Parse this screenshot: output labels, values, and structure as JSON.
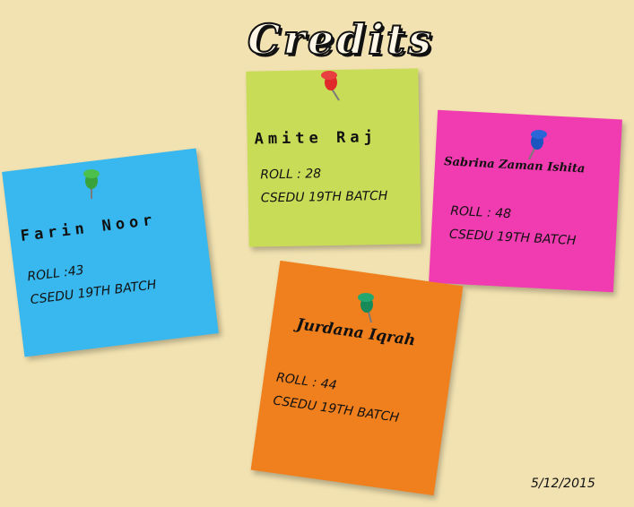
{
  "title": "Credits",
  "notes": {
    "green": {
      "name": "Amite Raj",
      "roll": "ROLL : 28",
      "batch": "CSEDU 19TH BATCH",
      "color": "#c8dc58",
      "pin_color": "#e02a2a"
    },
    "pink": {
      "name": "Sabrina Zaman Ishita",
      "roll": "ROLL  : 48",
      "batch": "CSEDU 19TH BATCH",
      "color": "#f03cb0",
      "pin_color": "#1a55c0"
    },
    "blue": {
      "name": "Farin Noor",
      "roll": "ROLL :43",
      "batch": "CSEDU 19TH BATCH",
      "color": "#38b8ee",
      "pin_color": "#3aa23a"
    },
    "orange": {
      "name": "Jurdana Iqrah",
      "roll": "ROLL : 44",
      "batch": "CSEDU 19TH BATCH",
      "color": "#f0801e",
      "pin_color": "#188a5a"
    }
  },
  "date": "5/12/2015"
}
